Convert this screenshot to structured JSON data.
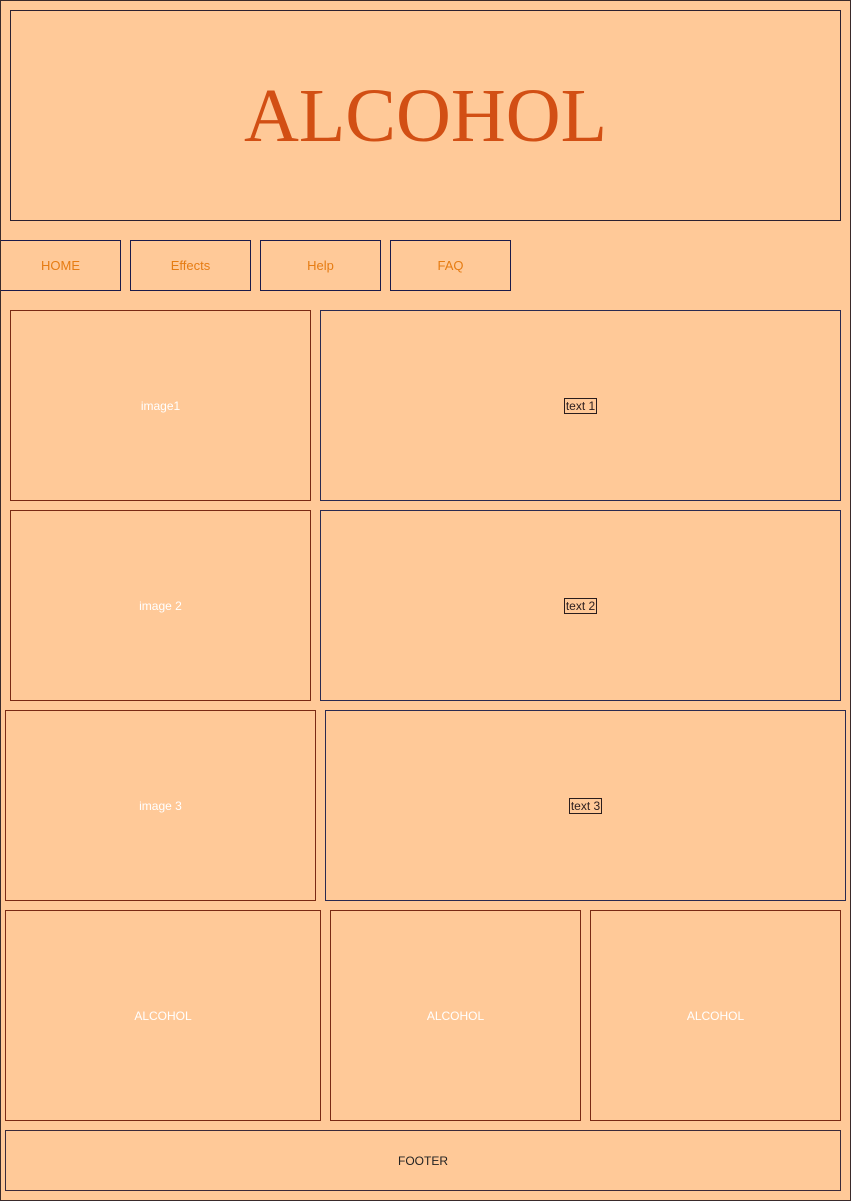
{
  "header": {
    "title": "ALCOHOL"
  },
  "nav": {
    "items": [
      {
        "label": "HOME"
      },
      {
        "label": "Effects"
      },
      {
        "label": "Help"
      },
      {
        "label": "FAQ"
      }
    ]
  },
  "rows": [
    {
      "image_label": "image1",
      "text_label": "text 1"
    },
    {
      "image_label": "image 2",
      "text_label": "text 2"
    },
    {
      "image_label": "image 3",
      "text_label": "text 3"
    }
  ],
  "tiles": [
    {
      "label": "ALCOHOL"
    },
    {
      "label": "ALCOHOL"
    },
    {
      "label": "ALCOHOL"
    }
  ],
  "footer": {
    "label": "FOOTER"
  },
  "colors": {
    "background": "#ffc998",
    "title": "#d24f14",
    "nav_text": "#e67c13"
  }
}
